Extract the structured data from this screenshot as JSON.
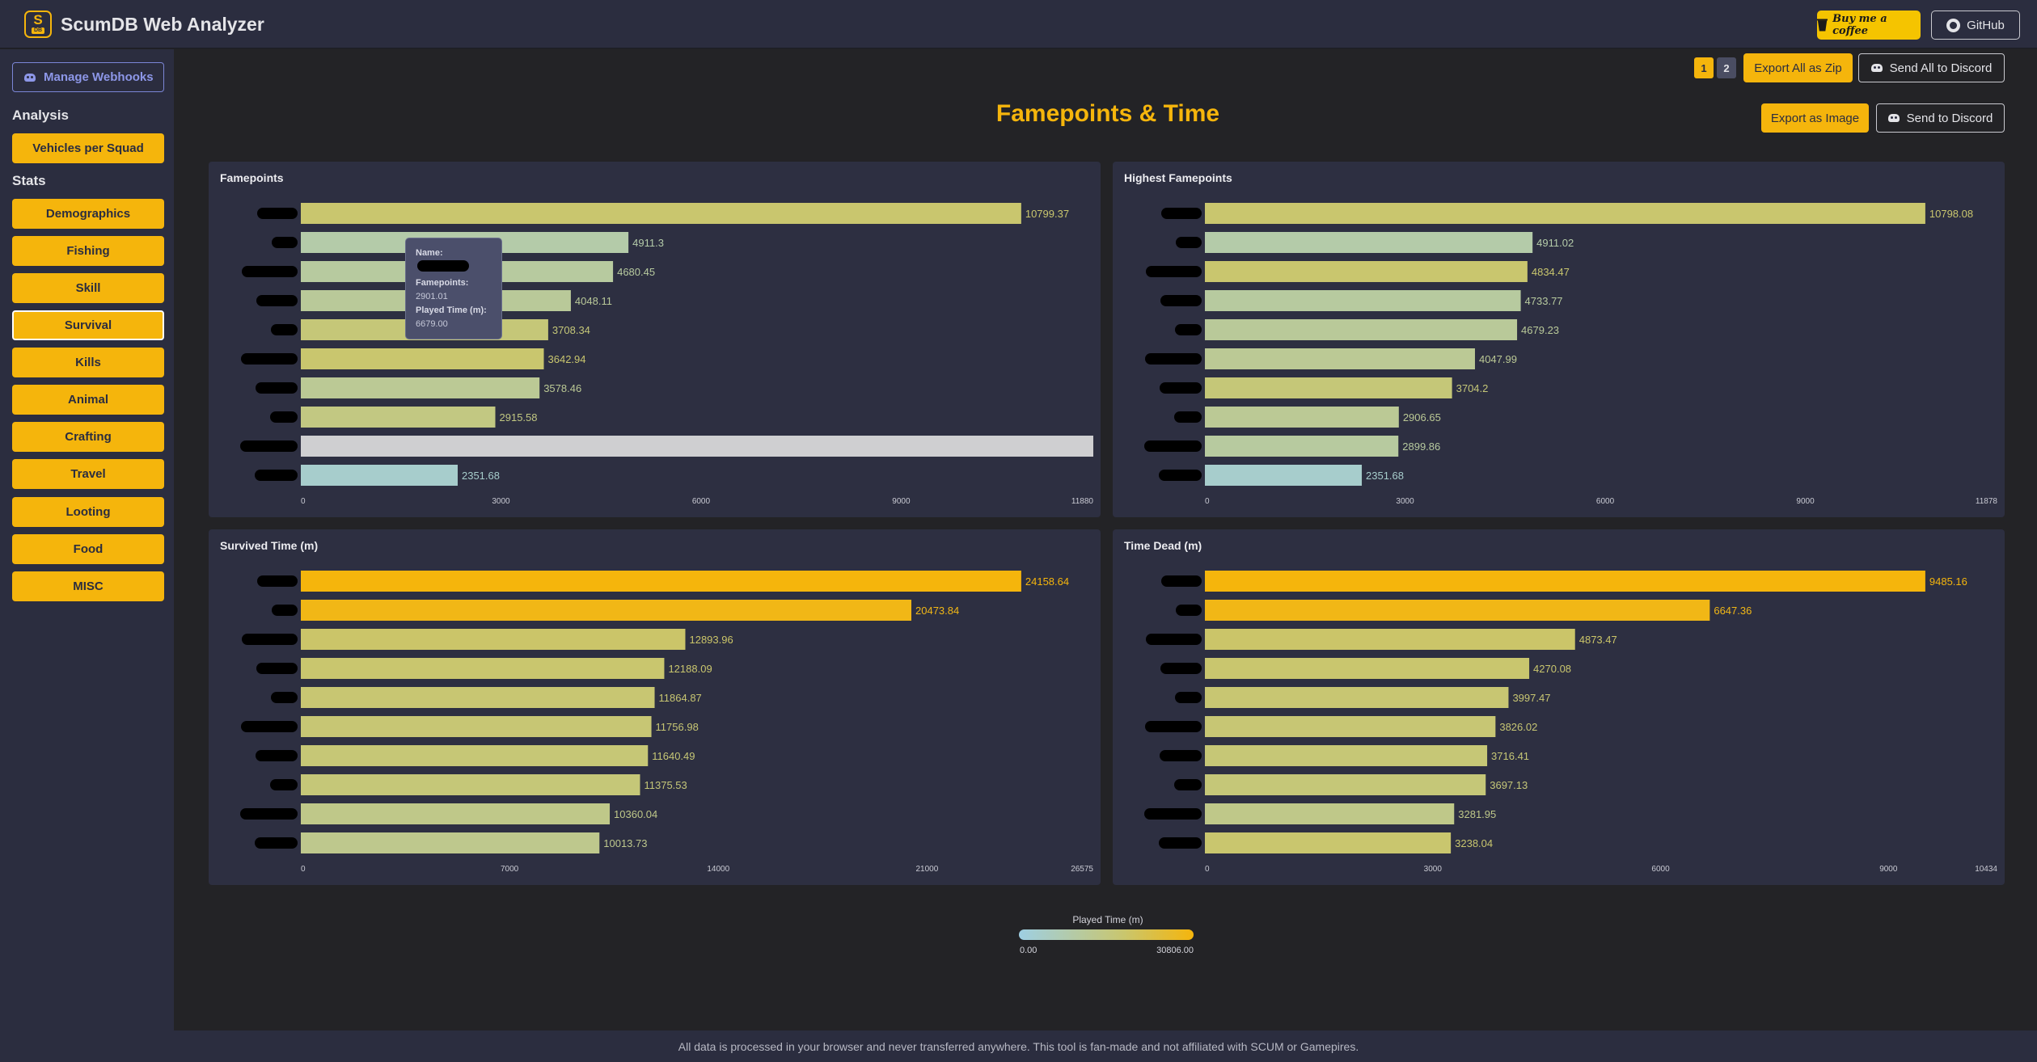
{
  "app": {
    "title": "ScumDB Web Analyzer",
    "logo_top": "S",
    "logo_bottom": "DB"
  },
  "header": {
    "coffee_label": "Buy me a coffee",
    "github_label": "GitHub"
  },
  "sidebar": {
    "webhooks_label": "Manage Webhooks",
    "analysis_heading": "Analysis",
    "analysis_items": [
      {
        "label": "Vehicles per Squad"
      }
    ],
    "stats_heading": "Stats",
    "stats_items": [
      {
        "label": "Demographics"
      },
      {
        "label": "Fishing"
      },
      {
        "label": "Skill"
      },
      {
        "label": "Survival",
        "active": true
      },
      {
        "label": "Kills"
      },
      {
        "label": "Animal"
      },
      {
        "label": "Crafting"
      },
      {
        "label": "Travel"
      },
      {
        "label": "Looting"
      },
      {
        "label": "Food"
      },
      {
        "label": "MISC"
      }
    ]
  },
  "toolbar": {
    "pages": [
      "1",
      "2"
    ],
    "current_page": "1",
    "export_all_label": "Export All as Zip",
    "send_all_label": "Send All to Discord",
    "export_image_label": "Export as Image",
    "send_discord_label": "Send to Discord"
  },
  "page_title": "Famepoints & Time",
  "tooltip": {
    "name_key": "Name:",
    "fame_key": "Famepoints:",
    "fame_value": "2901.01",
    "played_key": "Played Time (m):",
    "played_value": "6679.00"
  },
  "legend": {
    "title": "Played Time (m)",
    "min": "0.00",
    "max": "30806.00",
    "min_value": 0,
    "max_value": 30806,
    "color_low": "#9ecfe3",
    "color_high": "#f5b50c"
  },
  "colors": {
    "accent": "#f5b50c",
    "panel": "#2d2f41",
    "highlight_bar": "#cfcfd1"
  },
  "chart_data": [
    {
      "type": "bar",
      "orientation": "horizontal",
      "title": "Famepoints",
      "xlim": [
        0,
        11880
      ],
      "ticks": [
        "0",
        "3000",
        "6000",
        "9000",
        "11880"
      ],
      "values": [
        10799.37,
        4911.3,
        4680.45,
        4048.11,
        3708.34,
        3642.94,
        3578.46,
        2915.58,
        11880,
        2351.68
      ],
      "labels": [
        "10799.37",
        "4911.3",
        "4680.45",
        "4048.11",
        "3708.34",
        "3642.94",
        "3578.46",
        "2915.58",
        "",
        "2351.68"
      ],
      "color_t": [
        0.6,
        0.3,
        0.35,
        0.38,
        0.55,
        0.6,
        0.4,
        0.5,
        null,
        0.12
      ]
    },
    {
      "type": "bar",
      "orientation": "horizontal",
      "title": "Highest Famepoints",
      "xlim": [
        0,
        11878
      ],
      "ticks": [
        "0",
        "3000",
        "6000",
        "9000",
        "11878"
      ],
      "values": [
        10798.08,
        4911.02,
        4834.47,
        4733.77,
        4679.23,
        4047.99,
        3704.2,
        2906.65,
        2899.86,
        2351.68
      ],
      "labels": [
        "10798.08",
        "4911.02",
        "4834.47",
        "4733.77",
        "4679.23",
        "4047.99",
        "3704.2",
        "2906.65",
        "2899.86",
        "2351.68"
      ],
      "color_t": [
        0.6,
        0.3,
        0.6,
        0.35,
        0.38,
        0.4,
        0.55,
        0.4,
        0.35,
        0.12
      ]
    },
    {
      "type": "bar",
      "orientation": "horizontal",
      "title": "Survived Time (m)",
      "xlim": [
        0,
        26575
      ],
      "ticks": [
        "0",
        "7000",
        "14000",
        "21000",
        "26575"
      ],
      "values": [
        24158.64,
        20473.84,
        12893.96,
        12188.09,
        11864.87,
        11756.98,
        11640.49,
        11375.53,
        10360.04,
        10013.73
      ],
      "labels": [
        "24158.64",
        "20473.84",
        "12893.96",
        "12188.09",
        "11864.87",
        "11756.98",
        "11640.49",
        "11375.53",
        "10360.04",
        "10013.73"
      ],
      "color_t": [
        1.0,
        0.96,
        0.62,
        0.6,
        0.58,
        0.57,
        0.56,
        0.55,
        0.46,
        0.44
      ]
    },
    {
      "type": "bar",
      "orientation": "horizontal",
      "title": "Time Dead (m)",
      "xlim": [
        0,
        10434
      ],
      "ticks": [
        "0",
        "3000",
        "6000",
        "9000",
        "10434"
      ],
      "values": [
        9485.16,
        6647.36,
        4873.47,
        4270.08,
        3997.47,
        3826.02,
        3716.41,
        3697.13,
        3281.95,
        3238.04
      ],
      "labels": [
        "9485.16",
        "6647.36",
        "4873.47",
        "4270.08",
        "3997.47",
        "3826.02",
        "3716.41",
        "3697.13",
        "3281.95",
        "3238.04"
      ],
      "color_t": [
        1.0,
        0.96,
        0.62,
        0.6,
        0.58,
        0.57,
        0.56,
        0.55,
        0.46,
        0.6
      ]
    }
  ],
  "footer": {
    "text": "All data is processed in your browser and never transferred anywhere. This tool is fan-made and not affiliated with SCUM or Gamepires."
  }
}
